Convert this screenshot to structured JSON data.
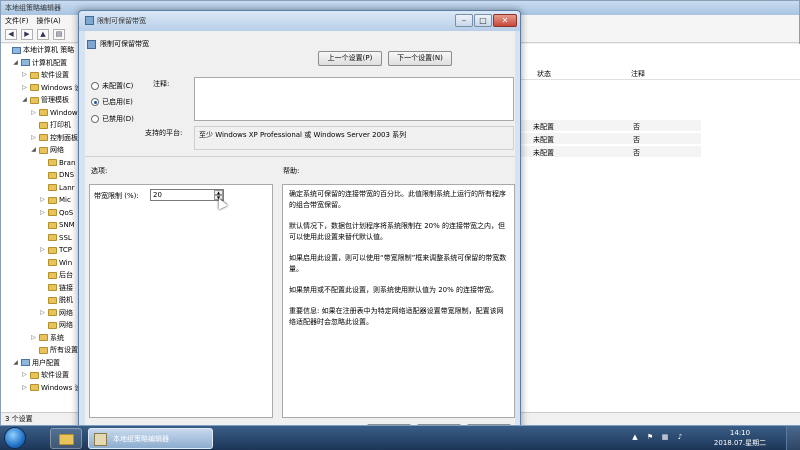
{
  "mmc": {
    "title": "本地组策略编辑器",
    "menu": [
      "文件(F)",
      "操作(A)"
    ],
    "tree": [
      {
        "label": "本地计算机 策略",
        "depth": 0,
        "icon": "computer"
      },
      {
        "label": "计算机配置",
        "depth": 1,
        "icon": "computer",
        "expander": "◢"
      },
      {
        "label": "软件设置",
        "depth": 2,
        "icon": "folder",
        "expander": "▷"
      },
      {
        "label": "Windows 设",
        "depth": 2,
        "icon": "folder",
        "expander": "▷"
      },
      {
        "label": "管理模板",
        "depth": 2,
        "icon": "folder",
        "expander": "◢"
      },
      {
        "label": "Window",
        "depth": 3,
        "icon": "folder",
        "expander": "▷"
      },
      {
        "label": "打印机",
        "depth": 3,
        "icon": "folder",
        "expander": ""
      },
      {
        "label": "控制面板",
        "depth": 3,
        "icon": "folder",
        "expander": "▷"
      },
      {
        "label": "网络",
        "depth": 3,
        "icon": "folder",
        "expander": "◢"
      },
      {
        "label": "Bran",
        "depth": 4,
        "icon": "folder",
        "expander": ""
      },
      {
        "label": "DNS",
        "depth": 4,
        "icon": "folder",
        "expander": ""
      },
      {
        "label": "Lanr",
        "depth": 4,
        "icon": "folder",
        "expander": ""
      },
      {
        "label": "Mic",
        "depth": 4,
        "icon": "folder",
        "expander": "▷"
      },
      {
        "label": "QoS",
        "depth": 4,
        "icon": "folder",
        "expander": "▷"
      },
      {
        "label": "SNM",
        "depth": 4,
        "icon": "folder",
        "expander": ""
      },
      {
        "label": "SSL",
        "depth": 4,
        "icon": "folder",
        "expander": ""
      },
      {
        "label": "TCP",
        "depth": 4,
        "icon": "folder",
        "expander": "▷"
      },
      {
        "label": "Win",
        "depth": 4,
        "icon": "folder",
        "expander": ""
      },
      {
        "label": "后台",
        "depth": 4,
        "icon": "folder",
        "expander": ""
      },
      {
        "label": "链接",
        "depth": 4,
        "icon": "folder",
        "expander": ""
      },
      {
        "label": "脱机",
        "depth": 4,
        "icon": "folder",
        "expander": ""
      },
      {
        "label": "网络",
        "depth": 4,
        "icon": "folder",
        "expander": "▷"
      },
      {
        "label": "网络",
        "depth": 4,
        "icon": "folder",
        "expander": ""
      },
      {
        "label": "系统",
        "depth": 3,
        "icon": "folder",
        "expander": "▷"
      },
      {
        "label": "所有设置",
        "depth": 3,
        "icon": "folder",
        "expander": ""
      },
      {
        "label": "用户配置",
        "depth": 1,
        "icon": "computer",
        "expander": "◢"
      },
      {
        "label": "软件设置",
        "depth": 2,
        "icon": "folder",
        "expander": "▷"
      },
      {
        "label": "Windows 设",
        "depth": 2,
        "icon": "folder",
        "expander": "▷"
      }
    ],
    "status": "3 个设置",
    "right_headers": {
      "state": "状态",
      "note": "注释"
    },
    "right_rows": [
      {
        "state": "未配置",
        "note": "否"
      },
      {
        "state": "未配置",
        "note": "否"
      },
      {
        "state": "未配置",
        "note": "否"
      }
    ]
  },
  "dialog": {
    "title": "限制可保留带宽",
    "policy_name": "限制可保留带宽",
    "prev_button": "上一个设置(P)",
    "next_button": "下一个设置(N)",
    "radios": [
      {
        "label": "未配置(C)",
        "checked": false
      },
      {
        "label": "已启用(E)",
        "checked": true
      },
      {
        "label": "已禁用(D)",
        "checked": false
      }
    ],
    "comment_label": "注释:",
    "supported_label": "支持的平台:",
    "supported_value": "至少 Windows XP Professional 或 Windows Server 2003 系列",
    "options_label": "选项:",
    "help_label": "帮助:",
    "bandwidth_label": "带宽限制 (%):",
    "bandwidth_value": "20",
    "help_paragraphs": [
      "确定系统可保留的连接带宽的百分比。此值限制系统上运行的所有程序的组合带宽保留。",
      "默认情况下，数据包计划程序将系统限制在 20% 的连接带宽之内，但可以使用此设置来替代默认值。",
      "如果启用此设置，则可以使用“带宽限制”框来调整系统可保留的带宽数量。",
      "如果禁用或不配置此设置，则系统使用默认值为 20% 的连接带宽。",
      "重要信息: 如果在注册表中为特定网络适配器设置带宽限制，配置该网络适配器时会忽略此设置。"
    ]
  },
  "taskbar": {
    "active_app": "本地组策略编辑器",
    "time": "14:10",
    "date": "2018.07.星期二"
  },
  "colors": {
    "accent": "#1c5aa6",
    "taskbar": "#1d3657"
  }
}
